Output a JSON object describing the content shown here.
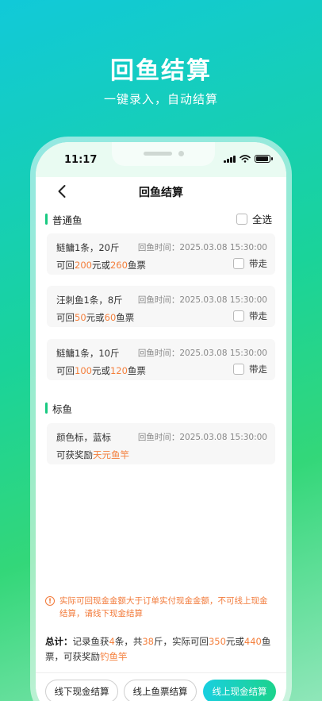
{
  "hero": {
    "title": "回鱼结算",
    "subtitle": "一键录入，自动结算"
  },
  "status_bar": {
    "time": "11:17"
  },
  "nav": {
    "title": "回鱼结算"
  },
  "common_section": {
    "title": "普通鱼",
    "select_all": "全选"
  },
  "common_items": [
    {
      "name": "鲢鳙1条，20斤",
      "time_label": "回鱼时间：2025.03.08  15:30:00",
      "prefix": "可回",
      "cash": "200",
      "mid": "元或",
      "tickets": "260",
      "suffix": "鱼票",
      "take_label": "带走"
    },
    {
      "name": "汪刺鱼1条，8斤",
      "time_label": "回鱼时间：2025.03.08  15:30:00",
      "prefix": "可回",
      "cash": "50",
      "mid": "元或",
      "tickets": "60",
      "suffix": "鱼票",
      "take_label": "带走"
    },
    {
      "name": "鲢鳙1条，10斤",
      "time_label": "回鱼时间：2025.03.08  15:30:00",
      "prefix": "可回",
      "cash": "100",
      "mid": "元或",
      "tickets": "120",
      "suffix": "鱼票",
      "take_label": "带走"
    }
  ],
  "tag_section": {
    "title": "标鱼"
  },
  "tag_item": {
    "name": "颜色标，蓝标",
    "time_label": "回鱼时间：2025.03.08  15:30:00",
    "prefix": "可获奖励",
    "reward": "天元鱼竿"
  },
  "warning": "实际可回现金金额大于订单实付现金金额，不可线上现金结算，请线下现金结算",
  "total": {
    "label": "总计：",
    "p1": "记录鱼获",
    "count": "4",
    "p2": "条，共",
    "weight": "38",
    "p3": "斤，实际可回",
    "cash": "350",
    "p4": "元或",
    "tickets": "440",
    "p5": "鱼票，可获奖励",
    "reward": "钓鱼竿"
  },
  "buttons": {
    "offline_cash": "线下现金结算",
    "online_tickets": "线上鱼票结算",
    "online_cash": "线上现金结算"
  },
  "colors": {
    "accent": "#19c981",
    "highlight": "#f47f3c"
  }
}
